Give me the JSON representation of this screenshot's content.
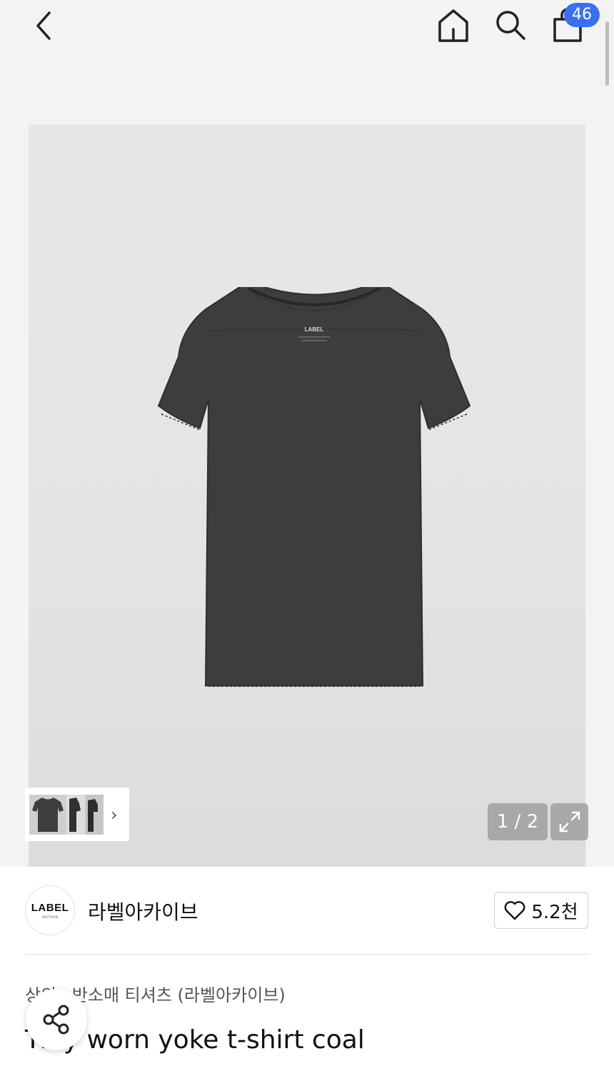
{
  "header": {
    "cart_count": "46"
  },
  "gallery": {
    "counter": "1 / 2",
    "shirt_label": "LABEL",
    "shirt_color": "#3c3e3d"
  },
  "brand": {
    "logo_text": "LABEL",
    "logo_subtext": "archive",
    "name": "라벨아카이브",
    "likes": "5.2천"
  },
  "product": {
    "breadcrumb": [
      "상의",
      "반소매 티셔츠 (라벨아카이브)"
    ],
    "title": "Tidy worn yoke t-shirt coal"
  },
  "colors": {
    "badge": "#3a6ff0",
    "background": "#f3f3f3"
  }
}
